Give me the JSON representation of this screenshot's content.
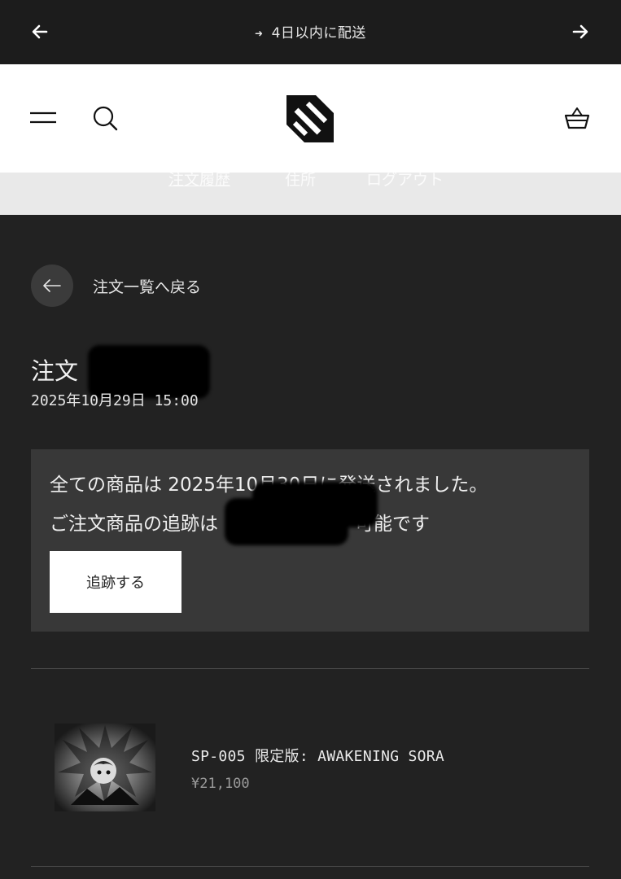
{
  "announcement": {
    "text": "4日以内に配送"
  },
  "subnav": {
    "items": [
      "注文履歴",
      "住所",
      "ログアウト"
    ]
  },
  "back": {
    "label": "注文一覧へ戻る"
  },
  "order": {
    "title_prefix": "注文",
    "date": "2025年10月29日 15:00"
  },
  "notice": {
    "line1": "全ての商品は 2025年10月30日に発送されました。",
    "line2_prefix": "ご注文商品の追跡は",
    "line2_suffix": "可能です",
    "track_button": "追跡する"
  },
  "product": {
    "name": "SP-005 限定版: AWAKENING SORA",
    "price": "¥21,100"
  },
  "icons": {
    "announce_left": "arrow-left-icon",
    "announce_right": "arrow-right-icon",
    "menu": "hamburger-menu-icon",
    "search": "search-icon",
    "logo": "brand-logo",
    "cart": "basket-icon",
    "back": "arrow-left-icon"
  }
}
